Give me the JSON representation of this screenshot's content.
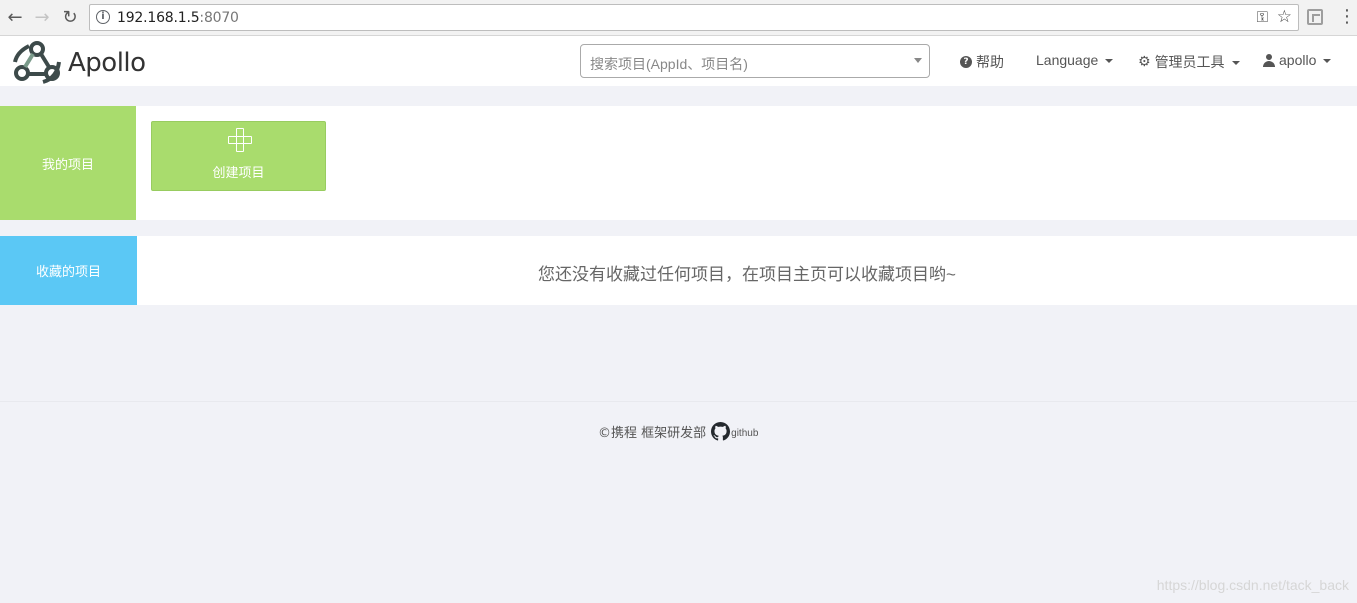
{
  "browser": {
    "back": "←",
    "forward": "→",
    "reload": "↻",
    "url_host": "192.168.1.5",
    "url_port": ":8070",
    "menu": "⋮"
  },
  "header": {
    "logo_text": "Apollo",
    "search_placeholder": "搜索项目(AppId、项目名)",
    "help": "帮助",
    "language": "Language",
    "admin_tools": "管理员工具",
    "user": "apollo"
  },
  "my_projects": {
    "label": "我的项目",
    "create_label": "创建项目"
  },
  "favorites": {
    "label": "收藏的项目",
    "empty_message": "您还没有收藏过任何项目，在项目主页可以收藏项目哟~"
  },
  "footer": {
    "copyright": "©携程 框架研发部",
    "github": "github"
  },
  "watermark": "https://blog.csdn.net/tack_back",
  "colors": {
    "my_projects_green": "#a9dc6d",
    "favorites_blue": "#5bc8f5",
    "page_bg": "#f1f2f7"
  }
}
